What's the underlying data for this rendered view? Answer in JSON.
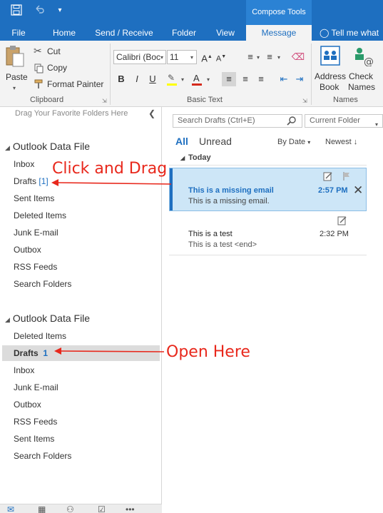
{
  "titlebar": {
    "qat_icons": [
      "save-icon",
      "undo-icon",
      "customize-qat-icon"
    ],
    "context_label": "Compose Tools"
  },
  "tabs": [
    "File",
    "Home",
    "Send / Receive",
    "Folder",
    "View",
    "Message"
  ],
  "tell_me": "Tell me what",
  "ribbon": {
    "clipboard": {
      "paste": "Paste",
      "cut": "Cut",
      "copy": "Copy",
      "format_painter": "Format Painter",
      "label": "Clipboard"
    },
    "basic_text": {
      "font": "Calibri (Boc",
      "size": "11",
      "grow": "A",
      "shrink": "A",
      "bold": "B",
      "italic": "I",
      "underline": "U",
      "font_color_letter": "A",
      "label": "Basic Text"
    },
    "names": {
      "address_book": [
        "Address",
        "Book"
      ],
      "check_names": [
        "Check",
        "Names"
      ],
      "label": "Names"
    }
  },
  "left_pane": {
    "drag_hint": "Drag Your Favorite Folders Here",
    "group1": {
      "title": "Outlook Data File",
      "folders": [
        {
          "name": "Inbox",
          "count": ""
        },
        {
          "name": "Drafts",
          "count": "[1]"
        },
        {
          "name": "Sent Items",
          "count": ""
        },
        {
          "name": "Deleted Items",
          "count": ""
        },
        {
          "name": "Junk E-mail",
          "count": ""
        },
        {
          "name": "Outbox",
          "count": ""
        },
        {
          "name": "RSS Feeds",
          "count": ""
        },
        {
          "name": "Search Folders",
          "count": ""
        }
      ]
    },
    "group2": {
      "title": "Outlook Data File",
      "folders": [
        {
          "name": "Deleted Items",
          "count": ""
        },
        {
          "name": "Drafts",
          "count": "1"
        },
        {
          "name": "Inbox",
          "count": ""
        },
        {
          "name": "Junk E-mail",
          "count": ""
        },
        {
          "name": "Outbox",
          "count": ""
        },
        {
          "name": "RSS Feeds",
          "count": ""
        },
        {
          "name": "Sent Items",
          "count": ""
        },
        {
          "name": "Search Folders",
          "count": ""
        }
      ]
    }
  },
  "bottom_nav": [
    "mail-icon",
    "calendar-icon",
    "people-icon",
    "tasks-icon",
    "more-icon"
  ],
  "message_list": {
    "search_placeholder": "Search Drafts (Ctrl+E)",
    "scope": "Current Folder",
    "filters": {
      "all": "All",
      "unread": "Unread"
    },
    "sort_by": "By Date",
    "order": "Newest",
    "group": "Today",
    "messages": [
      {
        "subject": "This is a missing email",
        "preview": "This is a missing email.",
        "time": "2:57 PM",
        "selected": true
      },
      {
        "subject": "This is a test",
        "preview": "This is a test <end>",
        "time": "2:32 PM",
        "selected": false
      }
    ]
  },
  "annotations": {
    "drag": "Click and Drag",
    "open": "Open Here"
  },
  "colors": {
    "accent": "#1e6fc0",
    "selection": "#cde6f7",
    "annotation": "#e8281c"
  }
}
